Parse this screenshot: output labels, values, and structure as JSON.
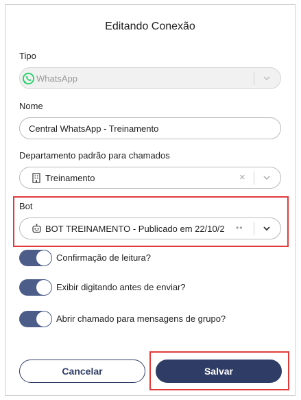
{
  "dialog": {
    "title": "Editando Conexão"
  },
  "tipo": {
    "label": "Tipo",
    "value": "WhatsApp",
    "icon": "whatsapp-icon",
    "disabled": true
  },
  "nome": {
    "label": "Nome",
    "value": "Central WhatsApp - Treinamento"
  },
  "departamento": {
    "label": "Departamento padrão para chamados",
    "value": "Treinamento",
    "icon": "building-icon",
    "clear_symbol": "×"
  },
  "bot": {
    "label": "Bot",
    "value": "BOT TREINAMENTO - Publicado em 22/10/2...",
    "icon": "robot-icon",
    "dots": "••"
  },
  "toggles": [
    {
      "label": "Confirmação de leitura?",
      "on": true
    },
    {
      "label": "Exibir digitando antes de enviar?",
      "on": true
    },
    {
      "label": "Abrir chamado para mensagens de grupo?",
      "on": true
    }
  ],
  "actions": {
    "cancel_label": "Cancelar",
    "save_label": "Salvar"
  },
  "colors": {
    "primary": "#2f3d66",
    "toggle_on": "#4d5d8a",
    "highlight": "#e23a3a",
    "whatsapp": "#25d366"
  }
}
